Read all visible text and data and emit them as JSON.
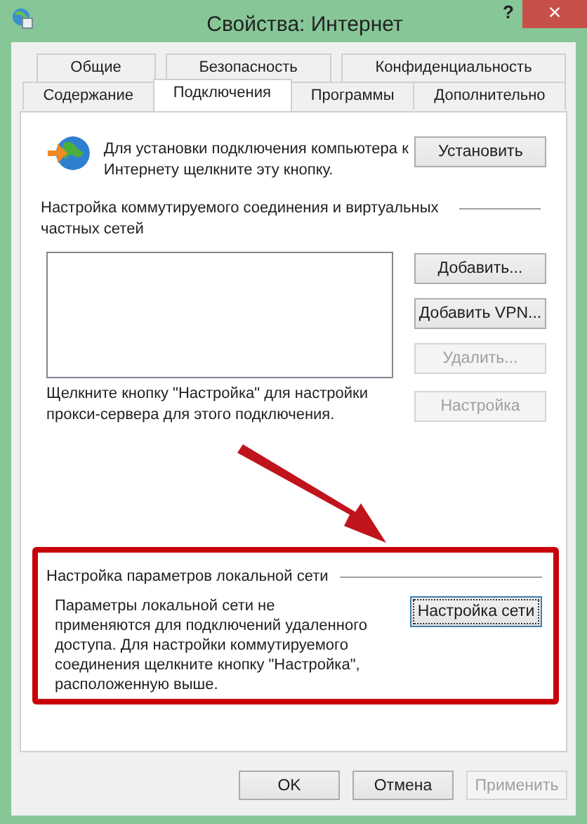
{
  "window": {
    "title": "Свойства: Интернет",
    "help": "?",
    "close": "×"
  },
  "tab_rows": [
    {
      "tabs": [
        {
          "label": "Общие",
          "selected": false
        },
        {
          "label": "Безопасность",
          "selected": false
        },
        {
          "label": "Конфиденциальность",
          "selected": false
        }
      ]
    },
    {
      "tabs": [
        {
          "label": "Содержание",
          "selected": false
        },
        {
          "label": "Подключения",
          "selected": true
        },
        {
          "label": "Программы",
          "selected": false
        },
        {
          "label": "Дополнительно",
          "selected": false
        }
      ]
    }
  ],
  "setup": {
    "text": "Для установки подключения компьютера к Интернету щелкните эту кнопку.",
    "button": {
      "label": "Установить",
      "disabled": false
    }
  },
  "dialup": {
    "heading": "Настройка коммутируемого соединения и виртуальных частных сетей",
    "buttons": [
      {
        "label": "Добавить...",
        "disabled": false
      },
      {
        "label": "Добавить VPN...",
        "disabled": false
      },
      {
        "label": "Удалить...",
        "disabled": true
      }
    ],
    "proxy_text": "Щелкните кнопку \"Настройка\" для настройки прокси-сервера для этого подключения.",
    "settings_button": {
      "label": "Настройка",
      "disabled": true
    }
  },
  "lan": {
    "heading": "Настройка параметров локальной сети",
    "text": "Параметры локальной сети не применяются для подключений удаленного доступа. Для настройки коммутируемого соединения щелкните кнопку \"Настройка\", расположенную выше.",
    "button": {
      "label": "Настройка сети",
      "disabled": false,
      "focused": true
    }
  },
  "buttons": [
    {
      "label": "OK",
      "disabled": false
    },
    {
      "label": "Отмена",
      "disabled": false
    },
    {
      "label": "Применить",
      "disabled": true
    }
  ]
}
